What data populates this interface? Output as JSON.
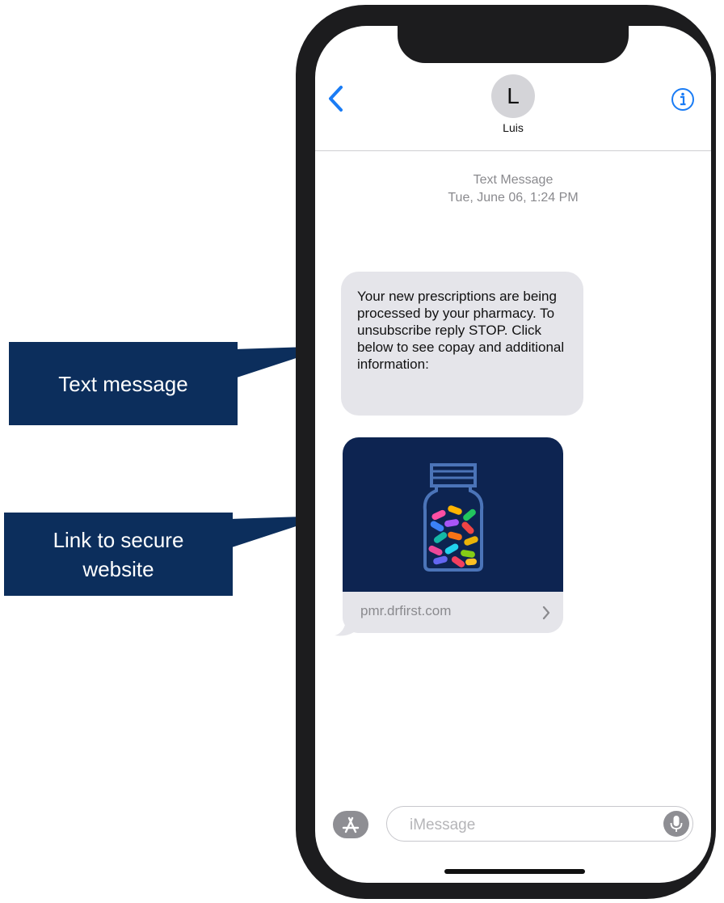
{
  "header": {
    "contact_initial": "L",
    "contact_name": "Luis"
  },
  "conversation": {
    "meta_label": "Text Message",
    "meta_timestamp": "Tue, June 06, 1:24 PM",
    "message_text": "Your new prescriptions are being processed by your pharmacy. To unsubscribe reply STOP. Click below to see copay and additional information:",
    "link_domain": "pmr.drfirst.com"
  },
  "callouts": {
    "text_message": "Text message",
    "link_label": "Link to secure website"
  },
  "input": {
    "placeholder": "iMessage"
  },
  "colors": {
    "accent": "#1a7cf5",
    "bubble_bg": "#e5e5ea",
    "callout_bg": "#0c2e5c",
    "card_image_bg": "#0d2451"
  },
  "icons": {
    "back": "chevron-left-icon",
    "info": "info-icon",
    "link_chevron": "chevron-right-icon",
    "apps": "app-store-icon",
    "mic": "microphone-icon",
    "card_image": "pill-bottle-icon"
  }
}
